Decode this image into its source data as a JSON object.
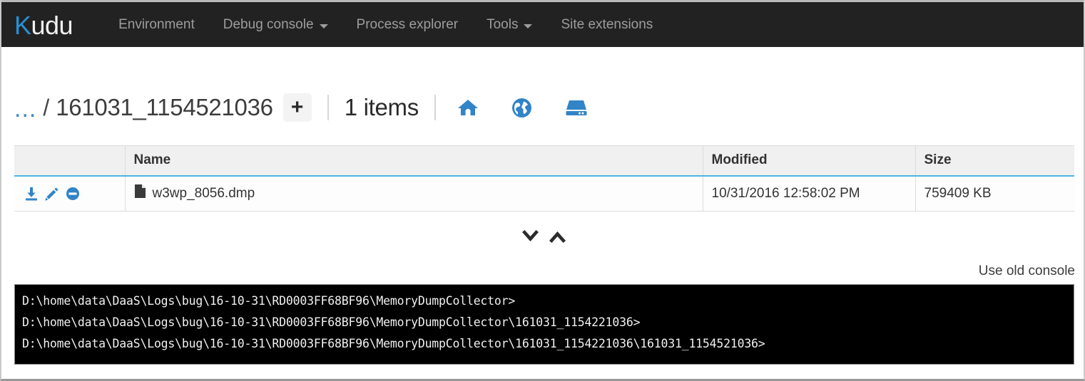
{
  "navbar": {
    "brand_first": "K",
    "brand_rest": "udu",
    "items": [
      {
        "label": "Environment",
        "caret": false
      },
      {
        "label": "Debug console",
        "caret": true
      },
      {
        "label": "Process explorer",
        "caret": false
      },
      {
        "label": "Tools",
        "caret": true
      },
      {
        "label": "Site extensions",
        "caret": false
      }
    ]
  },
  "breadcrumb": {
    "parent": "...",
    "separator": "/",
    "current": "161031_1154521036",
    "add_label": "+",
    "items_count": "1 items",
    "icons": [
      {
        "name": "home-icon",
        "title": "Home"
      },
      {
        "name": "globe-icon",
        "title": "Site"
      },
      {
        "name": "drive-icon",
        "title": "Drive"
      }
    ]
  },
  "table": {
    "headers": [
      "",
      "Name",
      "Modified",
      "Size"
    ],
    "rows": [
      {
        "actions": [
          "download-icon",
          "edit-icon",
          "delete-icon"
        ],
        "name": "w3wp_8056.dmp",
        "modified": "10/31/2016 12:58:02 PM",
        "size": "759409 KB"
      }
    ]
  },
  "pager": {
    "down_label": "scroll down",
    "up_label": "scroll up"
  },
  "console": {
    "old_console_link": "Use old console",
    "lines": [
      "D:\\home\\data\\DaaS\\Logs\\bug\\16-10-31\\RD0003FF68BF96\\MemoryDumpCollector>",
      "D:\\home\\data\\DaaS\\Logs\\bug\\16-10-31\\RD0003FF68BF96\\MemoryDumpCollector\\161031_1154221036>",
      "D:\\home\\data\\DaaS\\Logs\\bug\\16-10-31\\RD0003FF68BF96\\MemoryDumpCollector\\161031_1154221036\\161031_1154521036>"
    ]
  },
  "colors": {
    "navbar_bg": "#222222",
    "brand_accent": "#2a8fd4",
    "link_blue": "#3a87cd",
    "icon_blue": "#3184c6",
    "header_underline": "#4eb3e0",
    "console_bg": "#000000"
  }
}
